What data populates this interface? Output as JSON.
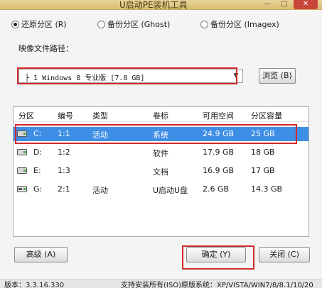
{
  "window": {
    "title": "U启动PE装机工具",
    "minimize": "—",
    "maximize": "□",
    "close": "✕"
  },
  "options": {
    "restore": "还原分区 (R)",
    "backup_ghost": "备份分区 (Ghost)",
    "backup_imagex": "备份分区 (Imagex)",
    "selected": "restore"
  },
  "image": {
    "label": "映像文件路径：",
    "value": "├ 1 Windows 8 专业版 [7.8 GB]",
    "browse": "浏览 (B)"
  },
  "table": {
    "headers": [
      "分区",
      "编号",
      "类型",
      "卷标",
      "可用空间",
      "分区容量"
    ],
    "rows": [
      {
        "partition": "C:",
        "number": "1:1",
        "type": "活动",
        "label": "系统",
        "free": "24.9 GB",
        "size": "25 GB",
        "selected": true
      },
      {
        "partition": "D:",
        "number": "1:2",
        "type": "",
        "label": "软件",
        "free": "17.9 GB",
        "size": "18 GB",
        "selected": false
      },
      {
        "partition": "E:",
        "number": "1:3",
        "type": "",
        "label": "文档",
        "free": "16.9 GB",
        "size": "17 GB",
        "selected": false
      },
      {
        "partition": "G:",
        "number": "2:1",
        "type": "活动",
        "label": "U启动U盘",
        "free": "2.6 GB",
        "size": "14.3 GB",
        "selected": false
      }
    ]
  },
  "buttons": {
    "advanced": "高级 (A)",
    "ok": "确定 (Y)",
    "close": "关闭 (C)"
  },
  "status": {
    "version": "版本：3.3.16.330",
    "support": "支持安装所有(ISO)原版系统：XP/VISTA/WIN7/8/8.1/10/20"
  },
  "colors": {
    "selection": "#3f8ee6",
    "highlight_box": "#d12a2a"
  }
}
